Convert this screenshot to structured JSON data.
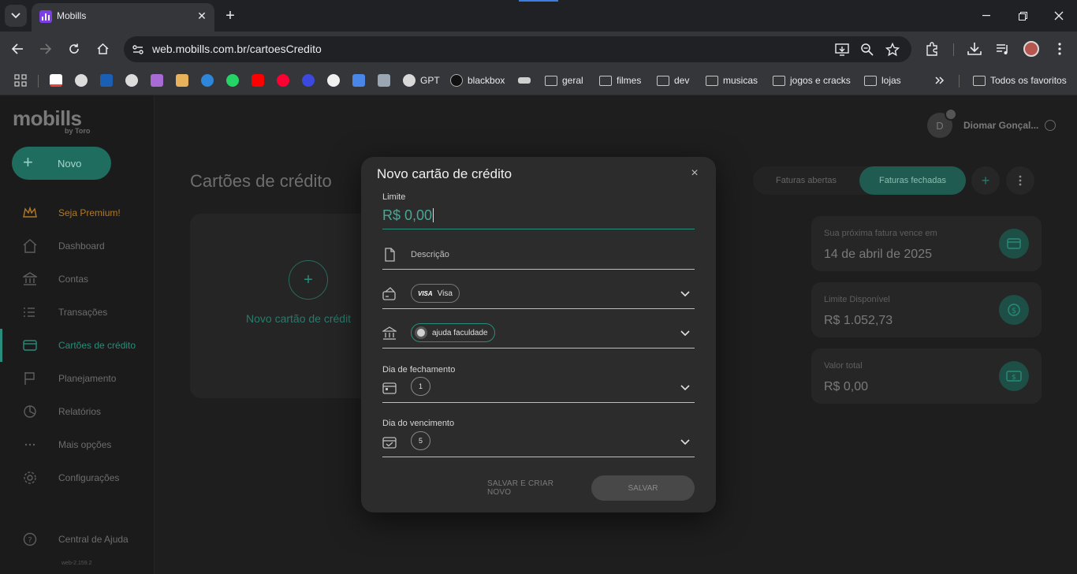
{
  "browser": {
    "tab_title": "Mobills",
    "url": "web.mobills.com.br/cartoesCredito",
    "bookmarks": [
      {
        "label": "",
        "icon": "apps-icon"
      },
      {
        "label": "",
        "icon": "gmail-icon"
      },
      {
        "label": "",
        "icon": "globe-icon"
      },
      {
        "label": "",
        "icon": "site-icon"
      },
      {
        "label": "",
        "icon": "globe-icon"
      },
      {
        "label": "",
        "icon": "site-icon"
      },
      {
        "label": "",
        "icon": "store-icon"
      },
      {
        "label": "",
        "icon": "site-icon"
      },
      {
        "label": "",
        "icon": "whatsapp-icon"
      },
      {
        "label": "",
        "icon": "youtube-icon"
      },
      {
        "label": "",
        "icon": "youtube-music-icon"
      },
      {
        "label": "",
        "icon": "site-icon"
      },
      {
        "label": "",
        "icon": "github-icon"
      },
      {
        "label": "",
        "icon": "translate-icon"
      },
      {
        "label": "",
        "icon": "site-icon"
      },
      {
        "label": "GPT",
        "icon": "openai-icon"
      },
      {
        "label": "blackbox",
        "icon": "blackbox-icon"
      },
      {
        "label": "",
        "icon": "site-icon"
      },
      {
        "label": "geral",
        "icon": "folder-icon"
      },
      {
        "label": "filmes",
        "icon": "folder-icon"
      },
      {
        "label": "dev",
        "icon": "folder-icon"
      },
      {
        "label": "musicas",
        "icon": "folder-icon"
      },
      {
        "label": "jogos e cracks",
        "icon": "folder-icon"
      },
      {
        "label": "lojas",
        "icon": "folder-icon"
      }
    ],
    "all_bookmarks": "Todos os favoritos"
  },
  "sidebar": {
    "logo": "mobills",
    "logo_sub": "by Toro",
    "new_label": "Novo",
    "items": [
      {
        "label": "Seja Premium!",
        "icon": "crown-icon"
      },
      {
        "label": "Dashboard",
        "icon": "home-icon"
      },
      {
        "label": "Contas",
        "icon": "bank-icon"
      },
      {
        "label": "Transações",
        "icon": "list-icon"
      },
      {
        "label": "Cartões de crédito",
        "icon": "card-icon"
      },
      {
        "label": "Planejamento",
        "icon": "flag-icon"
      },
      {
        "label": "Relatórios",
        "icon": "pie-icon"
      },
      {
        "label": "Mais opções",
        "icon": "dots-icon"
      },
      {
        "label": "Configurações",
        "icon": "gear-icon"
      }
    ],
    "help": "Central de Ajuda",
    "version": "web-2.159.2"
  },
  "main": {
    "title": "Cartões de crédito",
    "add_card_label": "Novo cartão de crédit",
    "user_initial": "D",
    "user_name": "Diomar Gonçal...",
    "tab_open": "Faturas abertas",
    "tab_closed": "Faturas fechadas",
    "cards": [
      {
        "label": "Sua próxima fatura vence em",
        "value": "14 de abril de 2025"
      },
      {
        "label": "Limite Disponível",
        "value": "R$ 1.052,73"
      },
      {
        "label": "Valor total",
        "value": "R$ 0,00"
      }
    ]
  },
  "modal": {
    "title": "Novo cartão de crédito",
    "limit_label": "Limite",
    "limit_value": "R$ 0,00",
    "description_placeholder": "Descrição",
    "brand_chip_logo": "VISA",
    "brand_chip_label": "Visa",
    "account_chip_label": "ajuda faculdade",
    "closing_label": "Dia de fechamento",
    "closing_value": "1",
    "due_label": "Dia do vencimento",
    "due_value": "5",
    "save_new_label": "SALVAR E CRIAR NOVO",
    "save_label": "SALVAR"
  },
  "colors": {
    "accent": "#2a8c7a",
    "modal_bg": "#2c2c2c",
    "app_bg": "#1e1e1e"
  }
}
